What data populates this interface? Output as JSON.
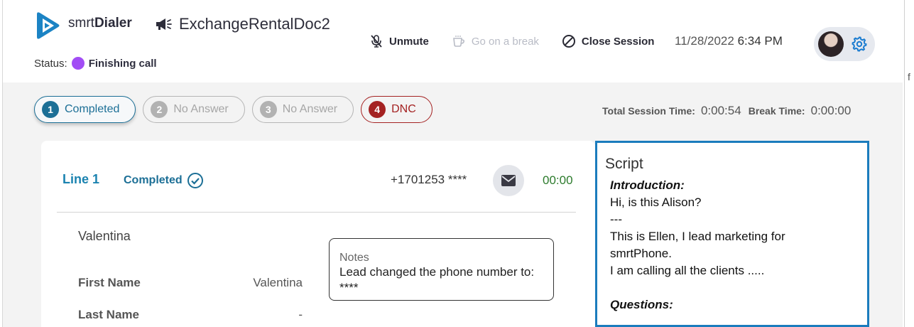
{
  "brand": {
    "name_light": "smrt",
    "name_bold": "Dialer"
  },
  "status": {
    "label": "Status:",
    "value": "Finishing call",
    "color": "#a24df5"
  },
  "campaign": {
    "icon": "megaphone-icon",
    "name": "ExchangeRentalDoc2"
  },
  "toolbar": {
    "unmute_label": "Unmute",
    "break_label": "Go on a break",
    "close_label": "Close Session"
  },
  "datetime": {
    "date": "11/28/2022",
    "time": "6:34 PM"
  },
  "user": {
    "avatar": "user-avatar",
    "settings_icon": "gear-icon"
  },
  "line_tabs": [
    {
      "num": "1",
      "label": "Completed"
    },
    {
      "num": "2",
      "label": "No Answer"
    },
    {
      "num": "3",
      "label": "No Answer"
    },
    {
      "num": "4",
      "label": "DNC"
    }
  ],
  "session": {
    "total_label": "Total Session Time:",
    "total_value": "0:00:54",
    "break_label": "Break Time:",
    "break_value": "0:00:00"
  },
  "line": {
    "label": "Line 1",
    "status": "Completed",
    "phone": "+1701253 ****",
    "timer": "00:00"
  },
  "contact": {
    "name": "Valentina",
    "fields": [
      {
        "label": "First Name",
        "value": "Valentina"
      },
      {
        "label": "Last Name",
        "value": "-"
      }
    ]
  },
  "notes": {
    "placeholder": "Notes",
    "text": "Lead changed the phone number to: ****"
  },
  "script": {
    "title": "Script",
    "lines": [
      "Introduction:",
      "Hi, is this Alison?",
      "---",
      "This is Ellen, I lead marketing for",
      "smrtPhone.",
      "I am calling all the clients .....",
      "",
      "Questions:"
    ]
  },
  "colors": {
    "accent": "#1c6f96",
    "dnc": "#a42222",
    "timer": "#2c7b2c",
    "script_border": "#1b7cbd"
  }
}
